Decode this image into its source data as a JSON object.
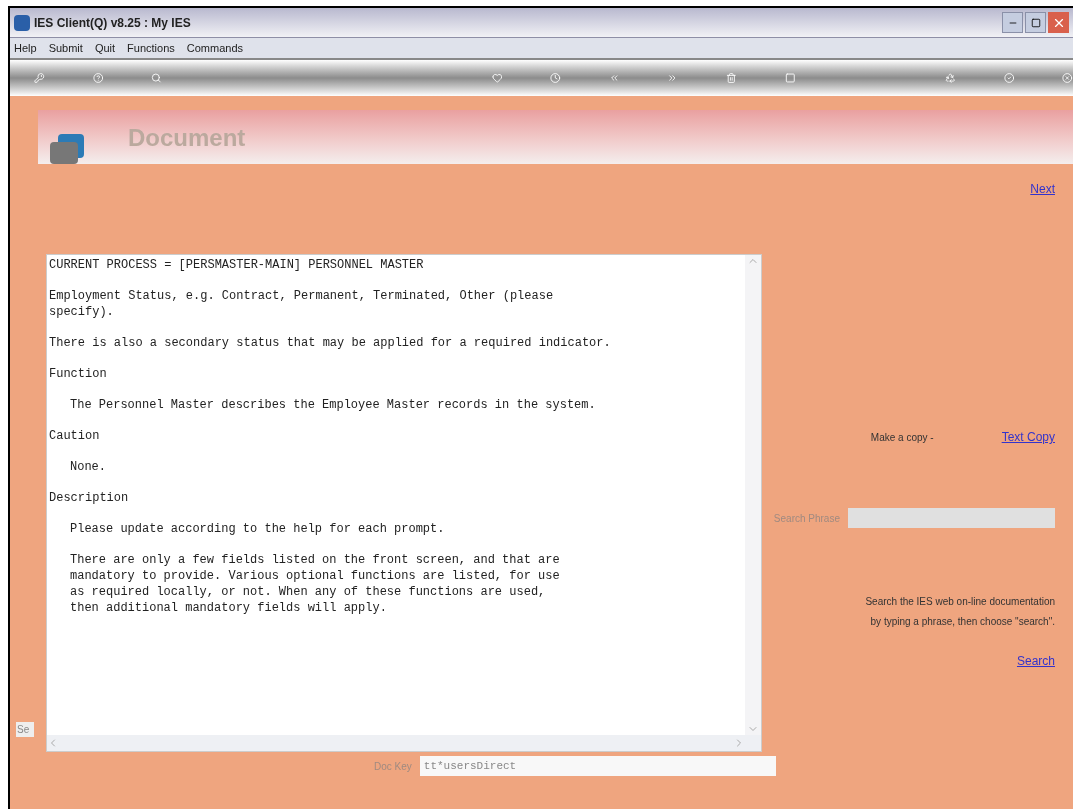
{
  "window": {
    "title": "IES Client(Q) v8.25 : My IES"
  },
  "menu": [
    "Help",
    "Submit",
    "Quit",
    "Functions",
    "Commands"
  ],
  "banner": {
    "title": "Document"
  },
  "next_link": "Next",
  "document": {
    "paragraphs": [
      {
        "indent": false,
        "lines": [
          "CURRENT PROCESS = [PERSMASTER-MAIN] PERSONNEL MASTER"
        ]
      },
      {
        "indent": false,
        "lines": [
          "Employment Status, e.g. Contract, Permanent, Terminated, Other (please",
          "specify)."
        ]
      },
      {
        "indent": false,
        "lines": [
          "There is also a secondary status that may be applied for a required indicator."
        ]
      },
      {
        "indent": false,
        "lines": [
          "Function"
        ]
      },
      {
        "indent": true,
        "lines": [
          "The Personnel Master describes the Employee Master records in the system."
        ]
      },
      {
        "indent": false,
        "lines": [
          "Caution"
        ]
      },
      {
        "indent": true,
        "lines": [
          "None."
        ]
      },
      {
        "indent": false,
        "lines": [
          "Description"
        ]
      },
      {
        "indent": true,
        "lines": [
          "Please update according to the help for each prompt."
        ]
      },
      {
        "indent": true,
        "lines": [
          "There are only a few fields listed on the front screen, and that are",
          "mandatory to provide. Various optional functions are listed, for use",
          "as required locally, or not. When any of these functions are used,",
          "then additional mandatory fields will apply."
        ]
      }
    ]
  },
  "copy": {
    "label": "Make a copy -",
    "link": "Text Copy"
  },
  "search": {
    "label": "Search Phrase",
    "hint_lines": [
      "Search the IES web on-line documentation",
      "by typing a phrase, then choose \"search\"."
    ],
    "link": "Search"
  },
  "left_tab": "Se",
  "doc_key": {
    "label": "Doc Key",
    "value": "tt*usersDirect"
  }
}
